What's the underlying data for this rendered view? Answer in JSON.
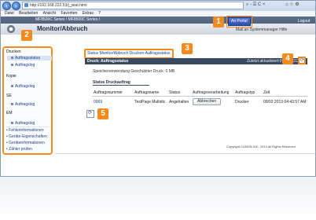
{
  "browser": {
    "url": "http://192.168.222.53/j_jstat.html",
    "search_placeholder": "⌕ - ☒ C ×",
    "window_controls": "⌂ ☆ ⚙"
  },
  "menu": [
    "Datei",
    "Bearbeiten",
    "Ansicht",
    "Favoriten",
    "Extras",
    "?"
  ],
  "header": {
    "product": "MF8500C Series / MF8500C Series /",
    "page_title": "Monitor/Abbruch",
    "portal_button": "An Portal",
    "logout": "Logout",
    "top_links": "Mail an Systemmanager  Hilfe"
  },
  "sidebar": {
    "sections": [
      {
        "category": "Drucken",
        "items": [
          "Auftragsstatus",
          "Auftragslog"
        ]
      },
      {
        "category": "Kopie",
        "items": [
          "Auftragslog"
        ]
      },
      {
        "category": "SE",
        "items": [
          "Auftragslog"
        ]
      },
      {
        "category": "EM",
        "items": [
          "Auftragslog"
        ]
      }
    ],
    "links": [
      "Fehlerinformationen",
      "Geräte-Eigenschaften",
      "Geräteinformationen",
      "Zähler prüfen"
    ]
  },
  "breadcrumb": "Status Monitor/Abbruch:Drucken:Auftragsstatus",
  "panel": {
    "title": "Druck: Auftragsstatus",
    "updated": "Zuletzt aktualisiert:09/03 2013 ..."
  },
  "memory": "Speicherverwendung Geschützter Druck:   0 MB",
  "status_section": "Status Druckauftrag",
  "table": {
    "headers": [
      "Auftragsnummer",
      "Auftragsname",
      "Status",
      "Auftragsverarbeitung",
      "Auftragstyp",
      "Zeit"
    ],
    "rows": [
      {
        "id": "0069",
        "name": "TestPage Multidic",
        "status": "Angehalten",
        "action": "Abbrechen",
        "type": "Drucker",
        "time": "09/03 2013 04:43:57 AM"
      }
    ]
  },
  "footer": "Copyright CANON INC. 2013 All Rights Reserved",
  "callouts": [
    "1",
    "2",
    "3",
    "4",
    "5"
  ],
  "colors": {
    "accent": "#f28a1e",
    "header": "#3b4a63",
    "link": "#1a3f8a"
  }
}
